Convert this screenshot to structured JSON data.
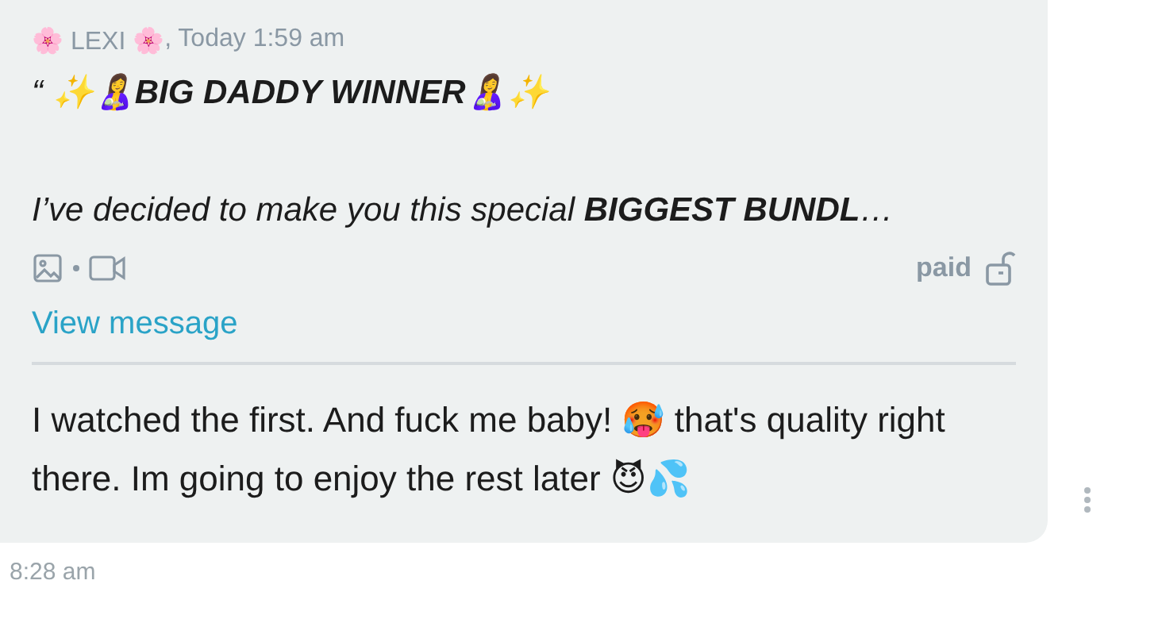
{
  "message": {
    "sender": "🌸 LEXI 🌸",
    "time": ", Today 1:59 am",
    "preview": {
      "title": "“ ✨🤱**BIG DADDY WINNER**🤱✨",
      "text": "I’ve decided to make you this special **BIGGEST BUNDL**…"
    },
    "media": {
      "paid_label": "paid",
      "unlocked": true
    },
    "link": "View message",
    "reply": "I watched the first. And fuck me baby! 🥵 that's quality right there. Im going to enjoy the rest later 😈💦"
  },
  "timestamp": "8:28 am"
}
